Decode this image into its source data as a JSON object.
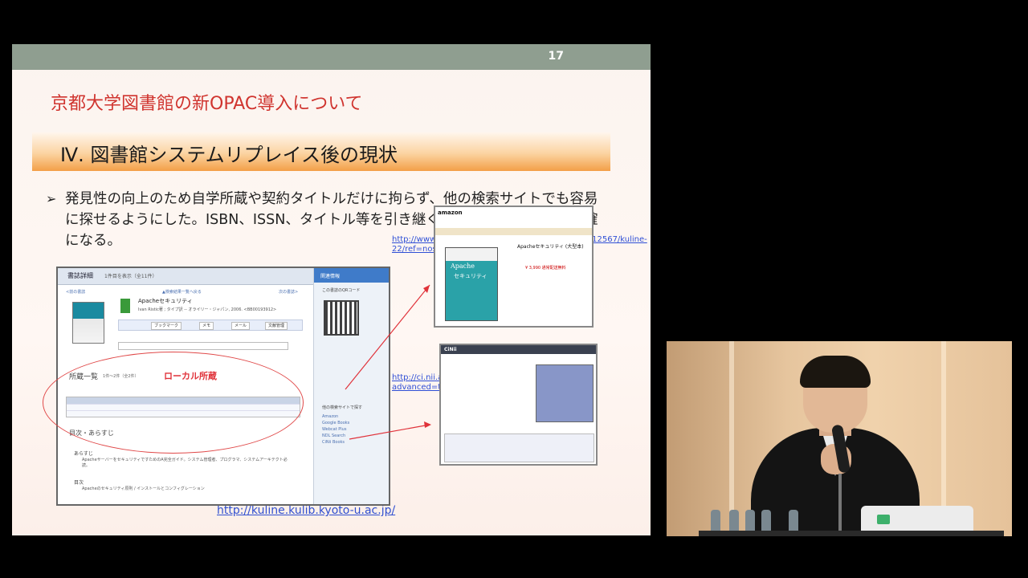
{
  "slide": {
    "page_number": "17",
    "deck_title": "京都大学図書館の新OPAC導入について",
    "section_title": "Ⅳ. 図書館システムリプレイス後の現状",
    "bullet_mark": "➢",
    "bullet_text": "発見性の向上のため自学所蔵や契約タイトルだけに拘らず、他の検索サイトでも容易に探せるようにした。ISBN、ISSN、タイトル等を引き継ぐ。→ILLのオーダーが正確になる。",
    "amazon_url": "http://www.amazon.co.jp/exec/obidos/ASIN/4873112567/kuline-22/ref=nosim",
    "cinii_url": "http://ci.nii.ac.jp/books/search?advanced=true&type=0&isbn=4873112567",
    "kuline_url": "http://kuline.kulib.kyoto-u.ac.jp/"
  },
  "opac": {
    "header_title": "書誌詳細",
    "header_sub": "1件目を表示（全11件）",
    "nav_prev": "<前の書誌",
    "nav_back": "▲検索結果一覧へ戻る",
    "nav_next": "次の書誌>",
    "book_title": "Apacheセキュリティ",
    "book_meta": "Ivan Ristic著 ; タイプ訳 -- オライリー・ジャパン, 2006. <BB00193912>",
    "toolbar_buttons": [
      "ブックマーク",
      "メモ",
      "メール",
      "文献管理"
    ],
    "holdings_label": "所蔵一覧",
    "holdings_count": "1件〜2件（全2件）",
    "local_holdings_label": "ローカル所蔵",
    "contents_label": "目次・あらすじ",
    "summary_label": "あらすじ",
    "summary_text": "ApacheサーバーをセキュリティですためのA完全ガイド。システム管理者、プログラマ、システムアーキテクト必読。",
    "toc_label": "目次",
    "toc_text": "Apacheのセキュリティ原則 / インストールとコンフィグレーション",
    "sidebar_head": "関連情報",
    "sidebar_qr_label": "この書誌のQRコード",
    "sidebar_links": [
      "他の検索サイトで探す",
      "Amazon",
      "Google Books",
      "Webcat Plus",
      "NDL Search",
      "CiNii Books"
    ]
  },
  "amazon": {
    "logo": "amazon",
    "cover_title": "Apache",
    "cover_sub": "セキュリティ",
    "product_title": "Apacheセキュリティ (大型本)",
    "price_note": "¥ 3,990 通常配送無料"
  },
  "cinii": {
    "logo": "CiNii"
  }
}
